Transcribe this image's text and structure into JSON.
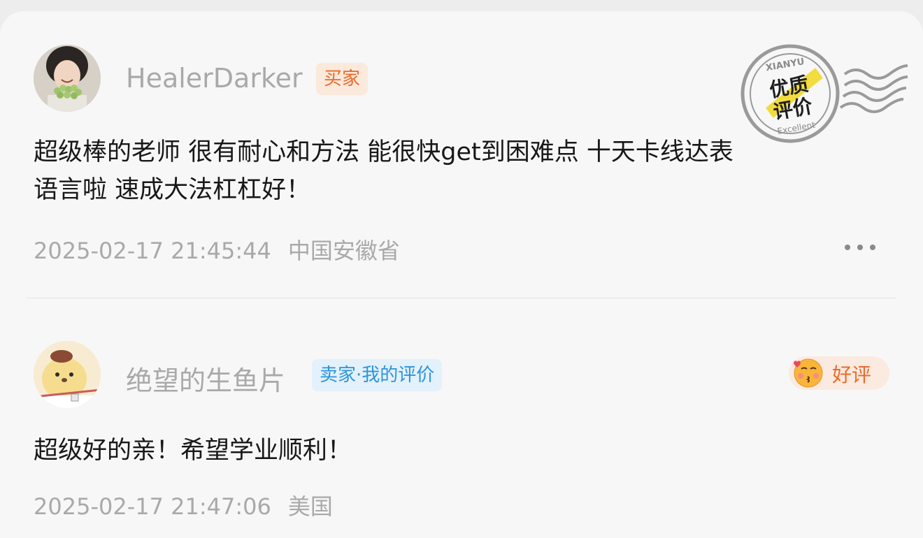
{
  "reviews": [
    {
      "username": "HealerDarker",
      "role_badge": "买家",
      "content_lines": [
        "超级棒的老师 很有耐心和方法 能很快get到困难点 十天卡线达表",
        "语言啦 速成大法杠杠好！"
      ],
      "timestamp": "2025-02-17 21:45:44",
      "location": "中国安徽省",
      "stamp": {
        "top_text": "XIANYU",
        "line1": "优质",
        "line2": "评价",
        "bottom_text": "Excellent"
      }
    },
    {
      "username": "绝望的生鱼片",
      "role_badge": "卖家·我的评价",
      "content_lines": [
        "超级好的亲！希望学业顺利！"
      ],
      "timestamp": "2025-02-17 21:47:06",
      "location": "美国",
      "rating": {
        "icon": "kiss-emoji-icon",
        "label": "好评"
      }
    }
  ],
  "colors": {
    "buyer_badge": "#ec6a2b",
    "seller_badge": "#2c94db",
    "rating_label": "#ec6a2b",
    "username": "#a9a9a9"
  }
}
